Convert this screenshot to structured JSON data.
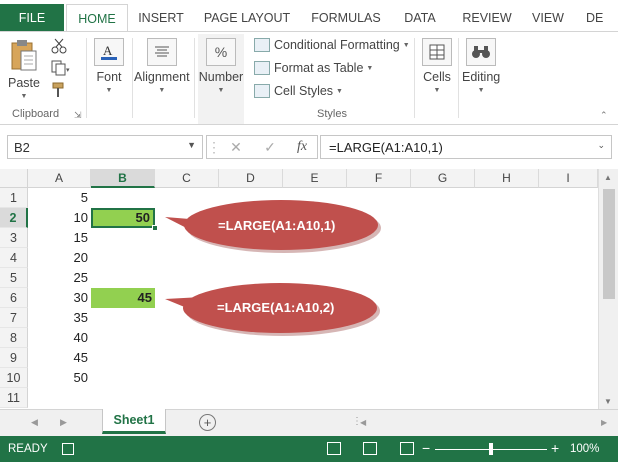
{
  "ribbon_tabs": {
    "file": "FILE",
    "home": "HOME",
    "insert": "INSERT",
    "page_layout": "PAGE LAYOUT",
    "formulas": "FORMULAS",
    "data": "DATA",
    "review": "REVIEW",
    "view": "VIEW",
    "developer_truncated": "DE"
  },
  "ribbon": {
    "clipboard": {
      "paste_label": "Paste",
      "group_label": "Clipboard"
    },
    "font_label": "Font",
    "alignment_label": "Alignment",
    "number_label": "Number",
    "number_icon": "%",
    "styles": {
      "conditional_formatting": "Conditional Formatting",
      "format_as_table": "Format as Table",
      "cell_styles": "Cell Styles",
      "group_label": "Styles"
    },
    "cells_label": "Cells",
    "editing_label": "Editing"
  },
  "formula_bar": {
    "name_box": "B2",
    "cancel_symbol": "✕",
    "enter_symbol": "✓",
    "fx_symbol": "fx",
    "formula": "=LARGE(A1:A10,1)"
  },
  "columns": [
    "A",
    "B",
    "C",
    "D",
    "E",
    "F",
    "G",
    "H",
    "I"
  ],
  "rows": [
    "1",
    "2",
    "3",
    "4",
    "5",
    "6",
    "7",
    "8",
    "9",
    "10",
    "11"
  ],
  "column_a_values": [
    "5",
    "10",
    "15",
    "20",
    "25",
    "30",
    "35",
    "40",
    "45",
    "50",
    ""
  ],
  "results": {
    "b2": "50",
    "b6": "45"
  },
  "callouts": {
    "first": "=LARGE(A1:A10,1)",
    "second": "=LARGE(A1:A10,2)"
  },
  "colors": {
    "excel_green": "#217346",
    "highlight_green": "#92d050",
    "callout_red": "#c0504d"
  },
  "sheet_tabs": [
    "Sheet1"
  ],
  "status_bar": {
    "ready": "READY",
    "zoom": "100%"
  }
}
